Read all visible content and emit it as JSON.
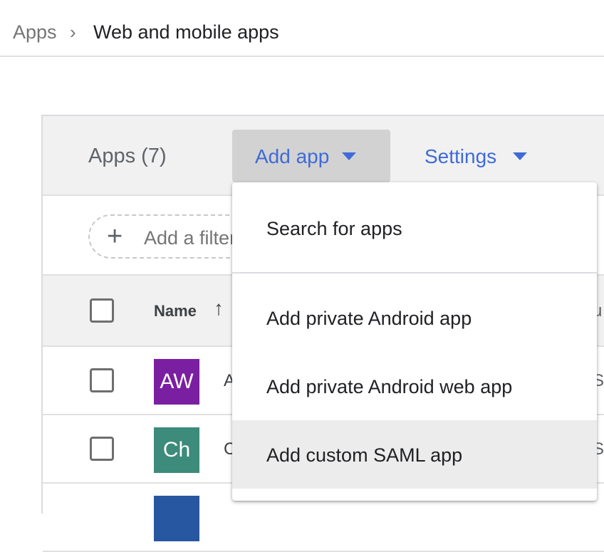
{
  "breadcrumb": {
    "root": "Apps",
    "separator": "›",
    "current": "Web and mobile apps"
  },
  "toolbar": {
    "apps_count_label": "Apps (7)",
    "add_app_label": "Add app",
    "settings_label": "Settings"
  },
  "filter": {
    "plus_icon": "+",
    "placeholder": "Add a filter"
  },
  "table": {
    "column_name": "Name",
    "sort_icon": "↑",
    "column_right_partial": "u",
    "rows": [
      {
        "avatar_text": "AW",
        "avatar_color": "#7b1fa2",
        "name_partial": "A",
        "right_partial": "S"
      },
      {
        "avatar_text": "Ch",
        "avatar_color": "#3d8b7a",
        "name_partial": "C",
        "right_partial": "S"
      },
      {
        "avatar_text": "",
        "avatar_color": "#2757a0",
        "name_partial": "",
        "right_partial": ""
      }
    ]
  },
  "add_app_menu": {
    "items": [
      {
        "label": "Search for apps"
      },
      {
        "label": "Add private Android app"
      },
      {
        "label": "Add private Android web app"
      },
      {
        "label": "Add custom SAML app"
      }
    ],
    "highlighted_index": 3
  },
  "colors": {
    "link_blue": "#3f6bd8",
    "toolbar_bg": "#f1f1f1",
    "add_app_active_bg": "#d2d2d2"
  }
}
